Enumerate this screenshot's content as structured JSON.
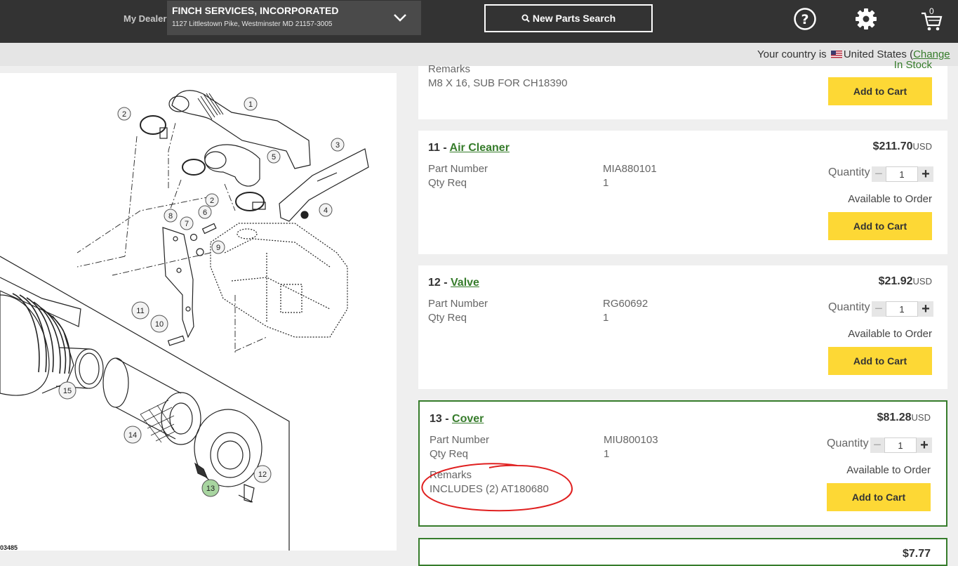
{
  "header": {
    "dealer_label": "My Dealer",
    "dealer_name": "FINCH SERVICES, INCORPORATED",
    "dealer_address": "1127 Littlestown Pike, Westminster MD 21157-3005",
    "search_label": "New Parts Search",
    "cart_count": "0",
    "icons": [
      "help-icon",
      "gear-icon",
      "cart-icon"
    ]
  },
  "country": {
    "prefix": "Your country is",
    "name": "United States",
    "open_paren": "(",
    "change_link": "Change"
  },
  "diagram": {
    "image_id": "03485",
    "callouts": [
      "1",
      "2",
      "3",
      "4",
      "5",
      "2",
      "6",
      "7",
      "8",
      "9",
      "10",
      "11",
      "15",
      "14",
      "13",
      "12"
    ],
    "highlighted_callout": "13"
  },
  "parts": {
    "partial": {
      "remarks_label": "Remarks",
      "remarks": "M8 X 16, SUB FOR CH18390",
      "status": "In Stock",
      "add_to_cart": "Add to Cart"
    },
    "items": [
      {
        "number": "11 - ",
        "name": "Air Cleaner",
        "price": "$211.70",
        "currency": "USD",
        "part_number_label": "Part Number",
        "part_number": "MIA880101",
        "qty_req_label": "Qty Req",
        "qty_req": "1",
        "quantity_label": "Quantity",
        "quantity": "1",
        "availability": "Available to Order",
        "add_to_cart": "Add to Cart"
      },
      {
        "number": "12 - ",
        "name": "Valve",
        "price": "$21.92",
        "currency": "USD",
        "part_number_label": "Part Number",
        "part_number": "RG60692",
        "qty_req_label": "Qty Req",
        "qty_req": "1",
        "quantity_label": "Quantity",
        "quantity": "1",
        "availability": "Available to Order",
        "add_to_cart": "Add to Cart"
      },
      {
        "number": "13 - ",
        "name": "Cover",
        "price": "$81.28",
        "currency": "USD",
        "part_number_label": "Part Number",
        "part_number": "MIU800103",
        "qty_req_label": "Qty Req",
        "qty_req": "1",
        "remarks_label": "Remarks",
        "remarks": "INCLUDES (2) AT180680",
        "quantity_label": "Quantity",
        "quantity": "1",
        "availability": "Available to Order",
        "add_to_cart": "Add to Cart"
      }
    ],
    "next_price": "$7.77"
  },
  "colors": {
    "header_bg": "#333333",
    "brand_green": "#367c2b",
    "cart_button": "#fdd835",
    "annotation_red": "#e02020"
  }
}
